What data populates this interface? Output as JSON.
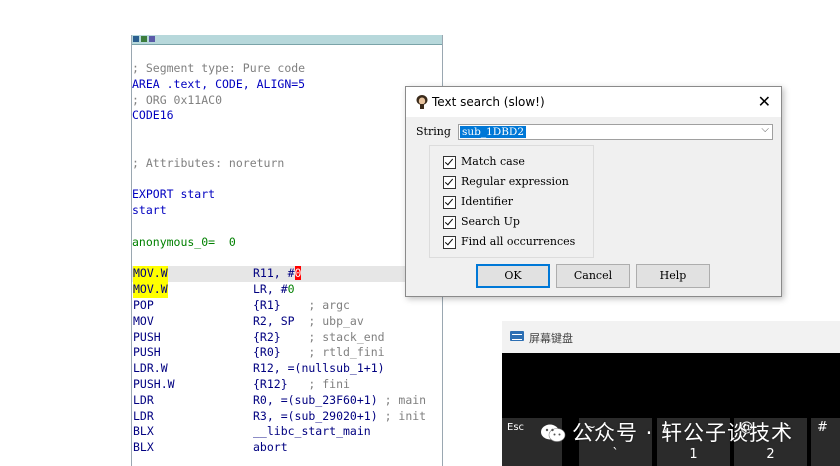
{
  "ida": {
    "lines": [
      {
        "text": "; Segment type: Pure code",
        "cls": "c-comment"
      },
      {
        "text": "AREA .text, CODE, ALIGN=5",
        "cls": "c-blue"
      },
      {
        "text": "; ORG 0x11AC0",
        "cls": "c-comment"
      },
      {
        "text": "CODE16",
        "cls": "c-blue"
      },
      {
        "text": "",
        "cls": ""
      },
      {
        "text": "",
        "cls": ""
      },
      {
        "text": "; Attributes: noreturn",
        "cls": "c-comment"
      },
      {
        "text": "",
        "cls": ""
      },
      {
        "text": "EXPORT start",
        "cls": "c-blue"
      },
      {
        "text": "start",
        "cls": "c-blue"
      },
      {
        "text": "",
        "cls": ""
      },
      {
        "text": "anonymous_0=  0",
        "cls": "c-green"
      },
      {
        "text": "",
        "cls": ""
      }
    ],
    "code": [
      {
        "mnemonic": "MOV.W",
        "yellow": true,
        "highlight": true,
        "operand": "R11, #",
        "cursor": "0",
        "comment": ""
      },
      {
        "mnemonic": "MOV.W",
        "yellow": true,
        "operand": "LR, #",
        "num": "0",
        "comment": ""
      },
      {
        "mnemonic": "POP",
        "operand": "{R1}    ",
        "comment": "; argc"
      },
      {
        "mnemonic": "MOV",
        "operand": "R2, SP  ",
        "comment": "; ubp_av"
      },
      {
        "mnemonic": "PUSH",
        "operand": "{R2}    ",
        "comment": "; stack_end"
      },
      {
        "mnemonic": "PUSH",
        "operand": "{R0}    ",
        "comment": "; rtld_fini"
      },
      {
        "mnemonic": "LDR.W",
        "operand": "R12, =(nullsub_1+1)",
        "comment": ""
      },
      {
        "mnemonic": "PUSH.W",
        "operand": "{R12}   ",
        "comment": "; fini"
      },
      {
        "mnemonic": "LDR",
        "operand": "R0, =(sub_23F60+1) ",
        "comment": "; main"
      },
      {
        "mnemonic": "LDR",
        "operand": "R3, =(sub_29020+1) ",
        "comment": "; init"
      },
      {
        "mnemonic": "BLX",
        "operand": "__libc_start_main",
        "comment": ""
      },
      {
        "mnemonic": "BLX",
        "operand": "abort",
        "comment": ""
      }
    ]
  },
  "dialog": {
    "title": "Text search (slow!)",
    "close": "✕",
    "string_label": "String",
    "string_value": "sub_1DBD2",
    "options": [
      {
        "label": "Match case",
        "checked": true
      },
      {
        "label": "Regular expression",
        "checked": true
      },
      {
        "label": "Identifier",
        "checked": true
      },
      {
        "label": "Search Up",
        "checked": true
      },
      {
        "label": "Find all occurrences",
        "checked": true
      }
    ],
    "ok": "OK",
    "cancel": "Cancel",
    "help": "Help"
  },
  "osk": {
    "title": "屏幕键盘",
    "keys": [
      {
        "top": "Esc",
        "bottom": ""
      },
      {
        "top": "~",
        "bottom": "`"
      },
      {
        "top": "!",
        "bottom": "1"
      },
      {
        "top": "@",
        "bottom": "2"
      },
      {
        "top": "#",
        "bottom": ""
      }
    ]
  },
  "watermark": "公众号 · 轩公子谈技术"
}
